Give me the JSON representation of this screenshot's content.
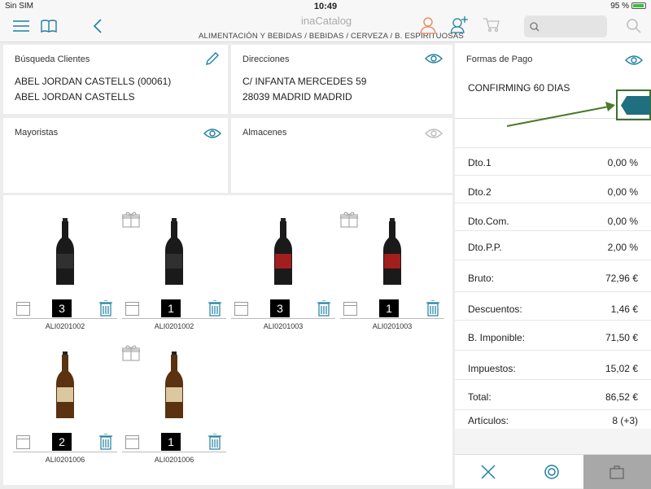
{
  "statusbar": {
    "carrier": "Sin SIM",
    "time": "10:49",
    "battery": "95 %"
  },
  "header": {
    "logo": "inaCatalog",
    "breadcrumb": "ALIMENTACIÓN Y BEBIDAS / BEBIDAS / CERVEZA / B. ESPIRITUOSAS",
    "search_placeholder": ""
  },
  "clientes": {
    "title": "Búsqueda Clientes",
    "line1": "ABEL JORDAN CASTELLS (00061)",
    "line2": "ABEL JORDAN CASTELLS"
  },
  "direcciones": {
    "title": "Direcciones",
    "line1": "C/ INFANTA MERCEDES 59",
    "line2": "28039 MADRID MADRID"
  },
  "mayoristas": {
    "title": "Mayoristas"
  },
  "almacenes": {
    "title": "Almacenes"
  },
  "pago": {
    "title": "Formas de Pago",
    "value": "CONFIRMING 60 DIAS"
  },
  "products": [
    {
      "code": "ALI0201002",
      "qty": "3",
      "gift": false,
      "type": "dark"
    },
    {
      "code": "ALI0201002",
      "qty": "1",
      "gift": true,
      "type": "dark"
    },
    {
      "code": "ALI0201003",
      "qty": "3",
      "gift": false,
      "type": "red"
    },
    {
      "code": "ALI0201003",
      "qty": "1",
      "gift": true,
      "type": "red"
    },
    {
      "code": "ALI0201006",
      "qty": "2",
      "gift": false,
      "type": "amber"
    },
    {
      "code": "ALI0201006",
      "qty": "1",
      "gift": true,
      "type": "amber"
    }
  ],
  "totals": [
    {
      "label": "Dto.1",
      "value": "0,00  %"
    },
    {
      "label": "Dto.2",
      "value": "0,00  %"
    },
    {
      "label": "Dto.Com.",
      "value": "0,00  %"
    },
    {
      "label": "Dto.P.P.",
      "value": "2,00  %"
    },
    {
      "label": "Bruto:",
      "value": "72,96 €"
    },
    {
      "label": "Descuentos:",
      "value": "1,46 €"
    },
    {
      "label": "B. Imponible:",
      "value": "71,50 €"
    },
    {
      "label": "Impuestos:",
      "value": "15,02 €"
    },
    {
      "label": "Total:",
      "value": "86,52 €"
    },
    {
      "label": "Artículos:",
      "value": "8 (+3)"
    }
  ],
  "colors": {
    "accent": "#1f7fa0",
    "arrow": "#4a7a2a",
    "tab": "#1f6f80"
  }
}
